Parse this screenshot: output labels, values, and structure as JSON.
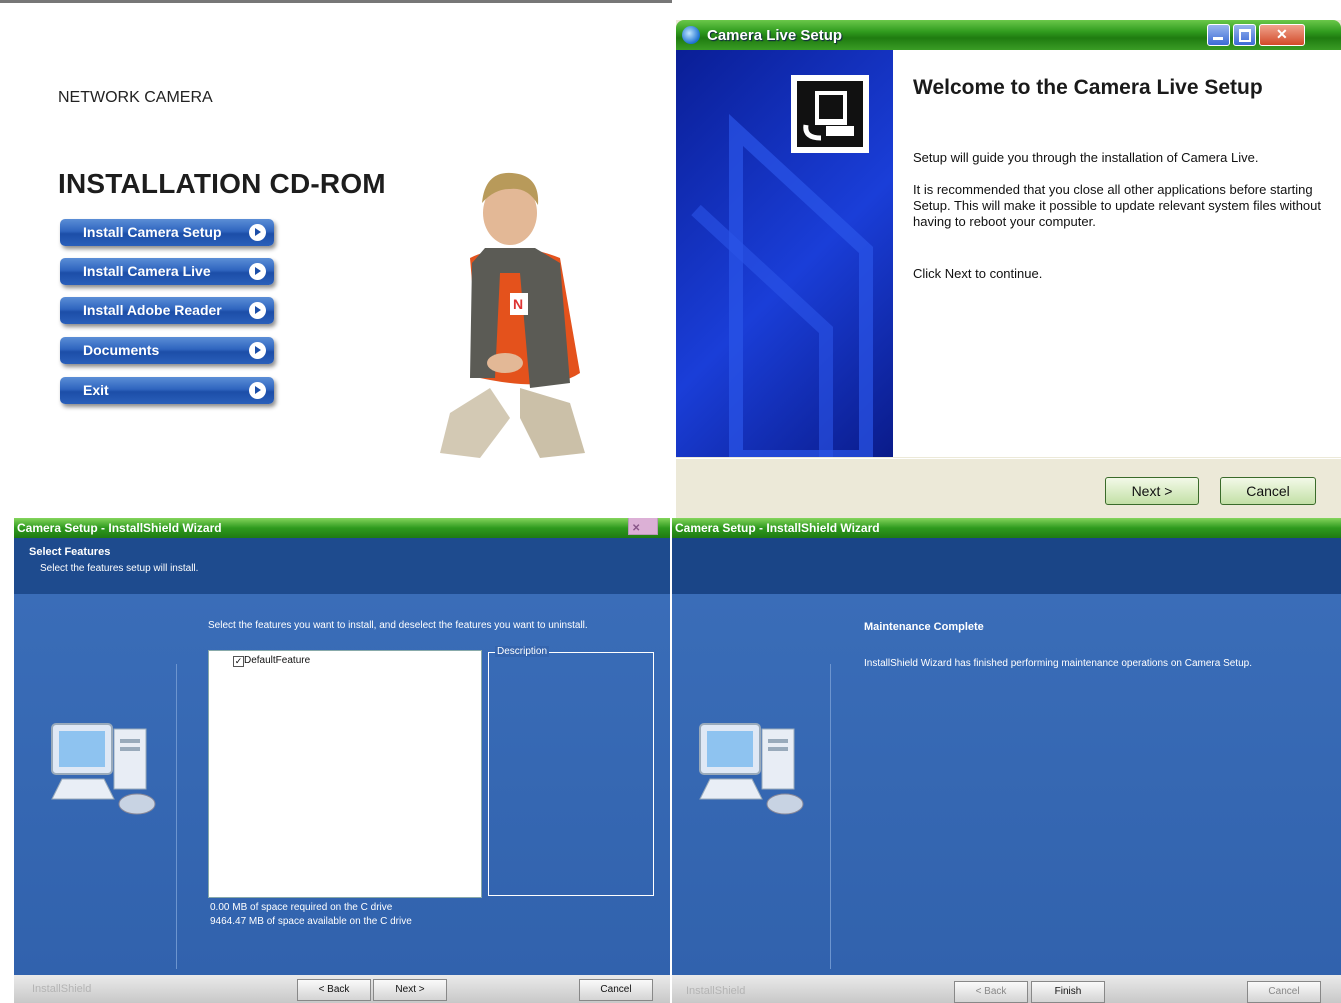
{
  "launcher": {
    "brand": "NETWORK CAMERA",
    "title": "INSTALLATION CD-ROM",
    "menu": [
      {
        "label": "Install Camera Setup"
      },
      {
        "label": "Install Camera Live"
      },
      {
        "label": "Install Adobe Reader"
      },
      {
        "label": "Documents"
      },
      {
        "label": "Exit"
      }
    ]
  },
  "camera_live": {
    "window_title": "Camera Live Setup",
    "heading": "Welcome to the Camera Live Setup",
    "p1": "Setup will guide you through the installation of Camera Live.",
    "p2": "It is recommended that you close all other applications before starting Setup. This will make it possible to update relevant system files without having to reboot your computer.",
    "p3": "Click Next to continue.",
    "next_label": "Next >",
    "cancel_label": "Cancel"
  },
  "select_features": {
    "window_title": "Camera Setup - InstallShield Wizard",
    "header_title": "Select Features",
    "header_subtitle": "Select the features setup will install.",
    "instruction": "Select the features you want to install, and deselect the features you want to uninstall.",
    "feature": "DefaultFeature",
    "description_label": "Description",
    "space_required": "0.00 MB of space required on the C drive",
    "space_available": "9464.47 MB of space available on the C drive",
    "brand": "InstallShield",
    "back_label": "< Back",
    "next_label": "Next >",
    "cancel_label": "Cancel",
    "close_glyph": "✕"
  },
  "maintenance": {
    "window_title": "Camera Setup - InstallShield Wizard",
    "heading": "Maintenance Complete",
    "message": "InstallShield Wizard has finished performing maintenance operations on Camera Setup.",
    "brand": "InstallShield",
    "back_label": "< Back",
    "finish_label": "Finish",
    "cancel_label": "Cancel"
  }
}
